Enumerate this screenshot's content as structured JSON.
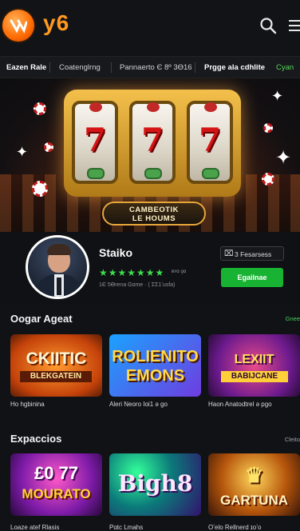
{
  "header": {
    "logo_text": "y6",
    "brand_color": "#ff9a1f",
    "icons": [
      "logo-mark-icon",
      "search-icon",
      "menu-icon"
    ]
  },
  "categories": [
    {
      "label": "Eazen Rale",
      "state": "active"
    },
    {
      "label": "Coatenglrng",
      "state": "normal"
    },
    {
      "label": "Pannaerto Є 8º 3Ө16",
      "state": "normal"
    },
    {
      "label": "Prgge ala cdhlite",
      "state": "active"
    },
    {
      "label": "Cyan",
      "state": "highlight"
    }
  ],
  "hero": {
    "tag_line1": "CAMBEOTIK",
    "tag_line2": "LE HOUMS",
    "reels": [
      "7",
      "7",
      "7"
    ]
  },
  "profile": {
    "name": "Staiko",
    "stars": "★★★★★★★",
    "rating_chip": "ʙʏα ǫα",
    "meta": "1Є 5Өrena Gɑme · ( ΣΣ1ʼusfa)",
    "stat_text": "3 Fesarsess",
    "stat_icon": "stat-icon",
    "button_label": "Egailnae",
    "accent_color": "#19b333"
  },
  "section1": {
    "title": "Oogar Ageat",
    "more": "Gnee",
    "cards": [
      {
        "art_l1": "CKIITIC",
        "art_l2": "BLEKGATEIN",
        "caption": "Ho hgbinina"
      },
      {
        "art_l1": "ROLIENITO",
        "art_l2": "EMONS",
        "caption": "Aleri Neoro Ioi1 ə go"
      },
      {
        "art_l1": "LEXIIT",
        "art_l2": "BABIJCANE",
        "caption": "Haon Anatodtrel ə pgo"
      }
    ]
  },
  "section2": {
    "title": "Expaccios",
    "more": "Cleito",
    "cards": [
      {
        "art_l1": "£0 77",
        "art_l2": "MOURATO",
        "caption": "Loaze atef Rlasis"
      },
      {
        "art_l1": "Bigh8",
        "art_l2": "",
        "caption": "Pɑtc Lmahs"
      },
      {
        "art_l1": "GARTUNA",
        "art_l2": "",
        "caption": "Oʼelo Rellnerd ɪoʼo"
      }
    ]
  }
}
